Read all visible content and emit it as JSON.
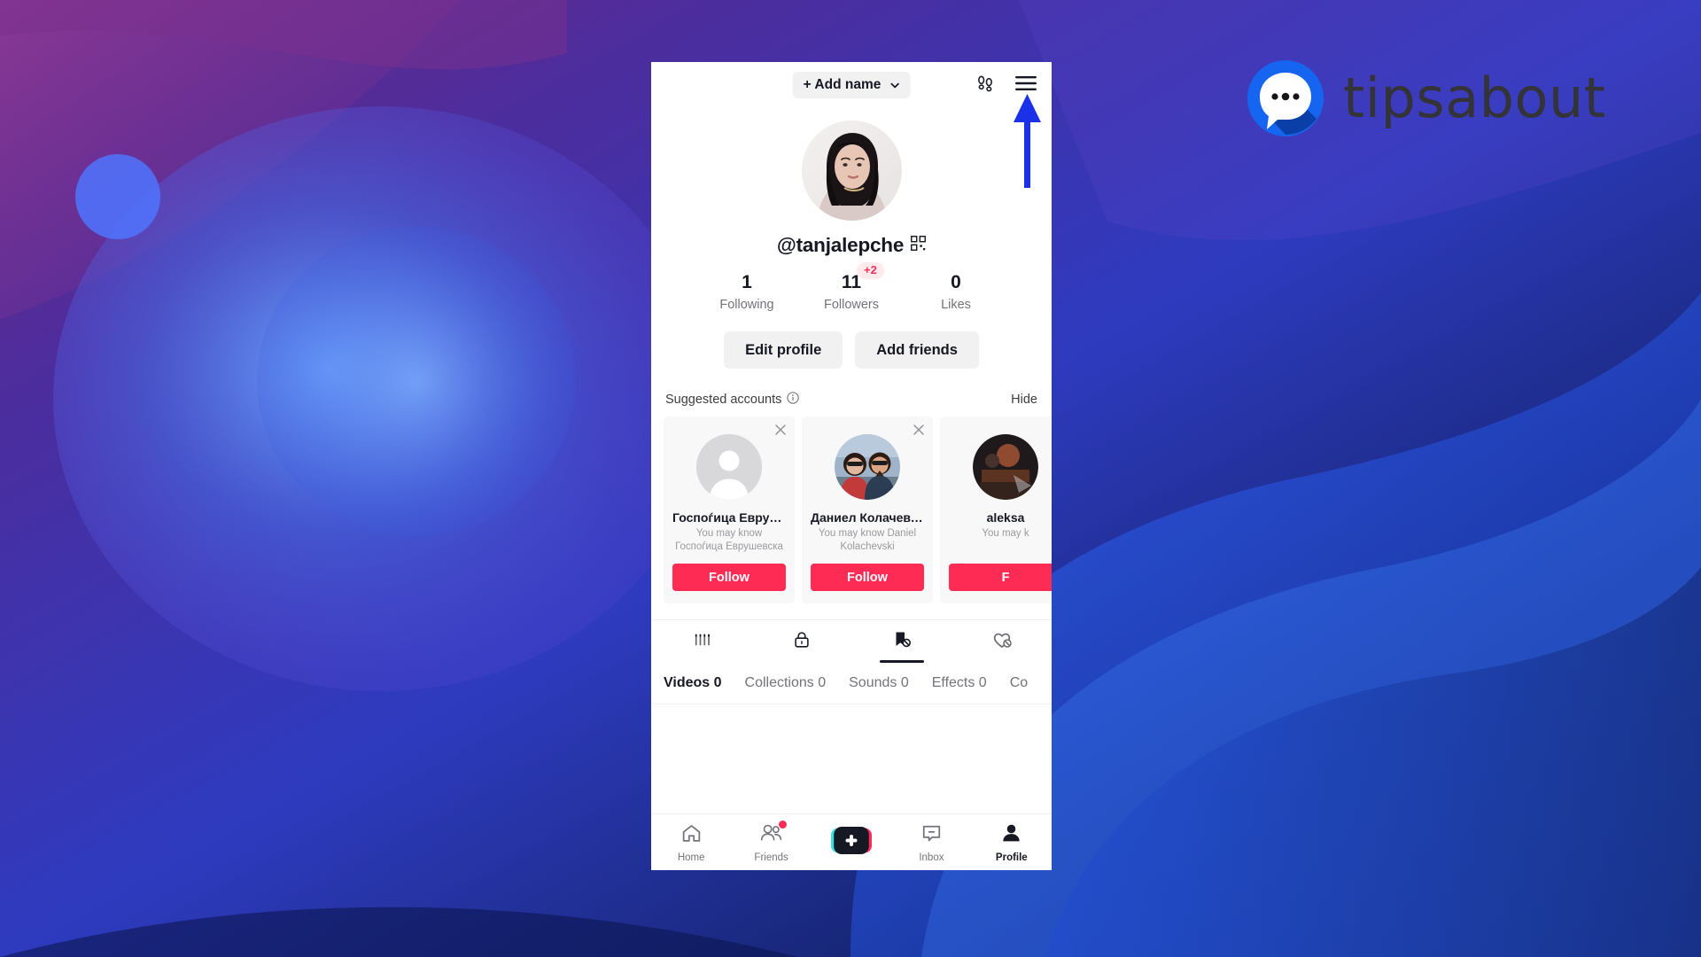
{
  "brand": {
    "name": "tipsabout",
    "logo_icon": "speech-bubble-dots-icon",
    "logo_circle_color": "#1565f0",
    "word_color": "#333338"
  },
  "annotation": {
    "arrow_icon": "up-arrow-annotation",
    "color": "#1a31e8",
    "points_to": "hamburger-menu-button"
  },
  "colors": {
    "accent_red": "#fe2c55",
    "text_primary": "#161823",
    "text_secondary": "#73747b",
    "chip_bg": "#f1f1f2",
    "card_bg": "#f8f8f8",
    "badge_bg": "#ffeaee"
  },
  "topbar": {
    "add_name_label": "+ Add name",
    "chevron_icon": "chevron-down-icon",
    "footprints_icon": "footprints-icon",
    "menu_icon": "hamburger-menu-icon"
  },
  "profile": {
    "avatar_icon": "user-avatar-photo",
    "handle": "@tanjalepche",
    "qr_icon": "qr-code-icon",
    "stats": [
      {
        "value": "1",
        "label": "Following",
        "badge": ""
      },
      {
        "value": "11",
        "label": "Followers",
        "badge": "+2"
      },
      {
        "value": "0",
        "label": "Likes",
        "badge": ""
      }
    ],
    "buttons": [
      {
        "label": "Edit profile",
        "name": "edit-profile-button"
      },
      {
        "label": "Add friends",
        "name": "add-friends-button"
      }
    ]
  },
  "suggested": {
    "title": "Suggested accounts",
    "info_icon": "info-circle-icon",
    "hide_label": "Hide",
    "close_icon": "close-x-icon",
    "follow_label": "Follow",
    "cards": [
      {
        "name": "Госпоѓица Еврушев...",
        "subtitle": "You may know Госпоѓица Еврушевска",
        "avatar_kind": "placeholder",
        "follow_label": "Follow"
      },
      {
        "name": "Даниел Колачевски",
        "subtitle": "You may know Daniel Kolachevski",
        "avatar_kind": "couple-photo",
        "follow_label": "Follow"
      },
      {
        "name": "aleksa",
        "subtitle": "You may k",
        "avatar_kind": "dark-photo",
        "follow_label": "F"
      }
    ]
  },
  "tabs": {
    "icons": [
      {
        "name": "tab-posts-grid",
        "icon": "grid-bars-icon",
        "active": false
      },
      {
        "name": "tab-private",
        "icon": "lock-icon",
        "active": false
      },
      {
        "name": "tab-favorites-hidden",
        "icon": "bookmark-hidden-icon",
        "active": true
      },
      {
        "name": "tab-liked-hidden",
        "icon": "heart-hidden-icon",
        "active": false
      }
    ],
    "subtabs": [
      {
        "label": "Videos 0",
        "active": true
      },
      {
        "label": "Collections 0",
        "active": false
      },
      {
        "label": "Sounds 0",
        "active": false
      },
      {
        "label": "Effects 0",
        "active": false
      },
      {
        "label": "Co",
        "active": false
      }
    ]
  },
  "bottomnav": [
    {
      "label": "Home",
      "icon": "home-icon",
      "active": false,
      "badge": false
    },
    {
      "label": "Friends",
      "icon": "friends-icon",
      "active": false,
      "badge": true
    },
    {
      "label": "",
      "icon": "create-plus-icon",
      "active": false,
      "badge": false
    },
    {
      "label": "Inbox",
      "icon": "inbox-icon",
      "active": false,
      "badge": false
    },
    {
      "label": "Profile",
      "icon": "profile-person-icon",
      "active": true,
      "badge": false
    }
  ]
}
